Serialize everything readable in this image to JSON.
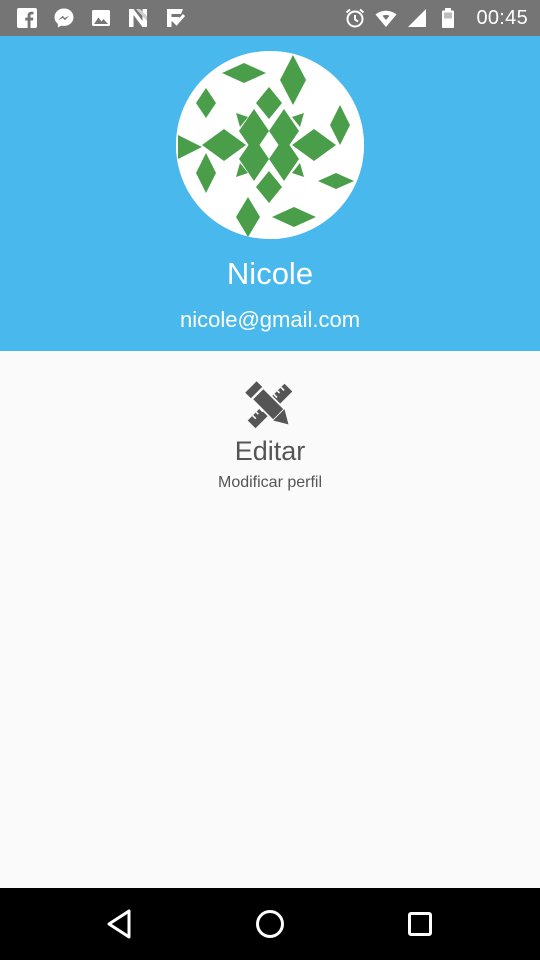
{
  "status_bar": {
    "time": "00:45",
    "left_icons": [
      "facebook-icon",
      "messenger-icon",
      "gallery-icon",
      "n-app-icon",
      "checkmark-app-icon"
    ],
    "right_icons": [
      "alarm-icon",
      "wifi-icon",
      "signal-icon",
      "battery-icon"
    ]
  },
  "profile": {
    "name": "Nicole",
    "email": "nicole@gmail.com",
    "avatar": "identicon-avatar",
    "header_color": "#49b8ec",
    "avatar_pattern_color": "#4a9e4a"
  },
  "edit_action": {
    "icon": "pencil-ruler-icon",
    "title": "Editar",
    "subtitle": "Modificar perfil"
  },
  "nav_bar": {
    "buttons": [
      "back-button",
      "home-button",
      "recents-button"
    ]
  }
}
